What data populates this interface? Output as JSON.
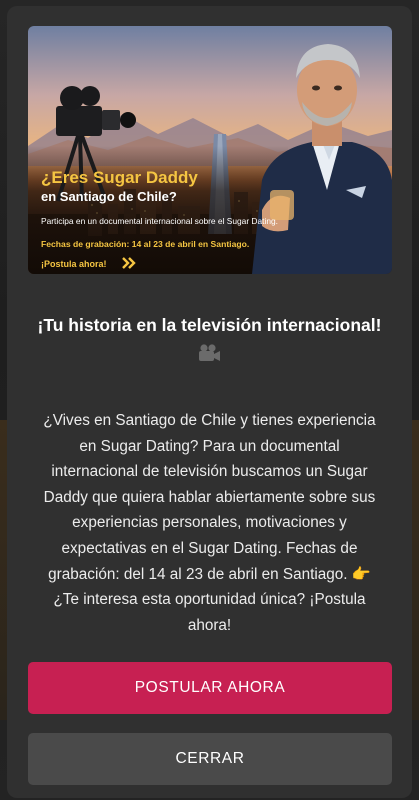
{
  "banner": {
    "headline": "¿Eres Sugar Daddy",
    "headline_line2": "en Santiago de Chile?",
    "subline": "Participa en un documental internacional sobre el Sugar Dating.",
    "dates": "Fechas de grabación: 14 al 23 de abril en Santiago.",
    "cta": "¡Postula ahora!",
    "accent_color": "#f5c542"
  },
  "modal": {
    "title": "¡Tu historia en la televisión internacional!",
    "title_icon": "movie-camera-icon",
    "body": "¿Vives en Santiago de Chile y tienes experiencia en Sugar Dating? Para un documental internacional de televisión buscamos un Sugar Daddy que quiera hablar abiertamente sobre sus experiencias personales, motivaciones y expectativas en el Sugar Dating. Fechas de grabación: del 14 al 23 de abril en Santiago. 👉 ¿Te interesa esta oportunidad única? ¡Postula ahora!",
    "primary_button": "POSTULAR AHORA",
    "secondary_button": "CERRAR",
    "primary_color": "#c72052",
    "secondary_color": "#4a4a4a"
  }
}
